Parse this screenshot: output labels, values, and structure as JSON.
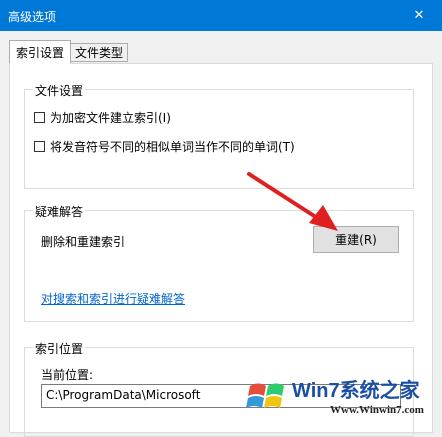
{
  "window": {
    "title": "高级选项",
    "close_glyph": "✕",
    "title_bg": "#0078d7"
  },
  "tabs": [
    {
      "label": "索引设置",
      "active": true
    },
    {
      "label": "文件类型",
      "active": false
    }
  ],
  "file_settings": {
    "legend": "文件设置",
    "options": [
      {
        "label": "为加密文件建立索引(I)",
        "checked": false
      },
      {
        "label": "将发音符号不同的相似单词当作不同的单词(T)",
        "checked": false
      }
    ]
  },
  "troubleshoot": {
    "legend": "疑难解答",
    "rebuild_desc": "删除和重建索引",
    "rebuild_button": "重建(R)",
    "link": "对搜索和索引进行疑难解答"
  },
  "index_location": {
    "legend": "索引位置",
    "current_label": "当前位置:",
    "current_value": "C:\\ProgramData\\Microsoft"
  },
  "annotation": {
    "arrow_color": "#e02020"
  },
  "watermark": {
    "brand": "Win7系统之家",
    "url": "Www.Winwin7.com",
    "accent": "#1a4fa3"
  }
}
